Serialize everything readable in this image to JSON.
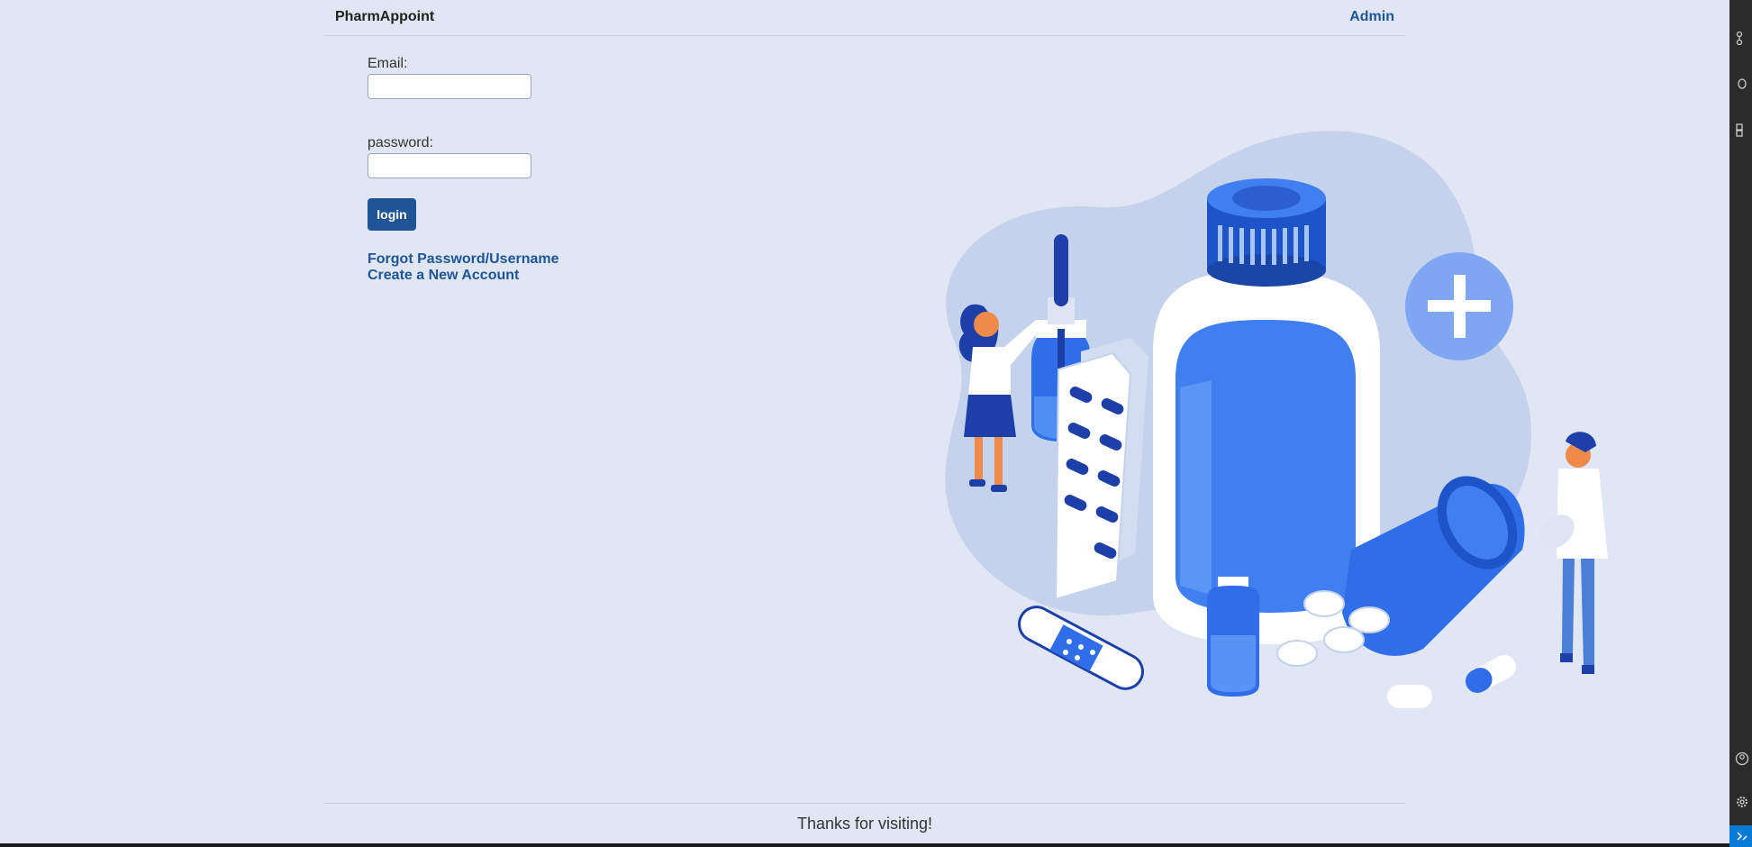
{
  "header": {
    "brand": "PharmAppoint",
    "admin_link": "Admin"
  },
  "login_form": {
    "email_label": "Email:",
    "email_value": "",
    "password_label": "password:",
    "password_value": "",
    "login_button": "login"
  },
  "links": {
    "forgot": "Forgot Password/Username",
    "create_account": "Create a New Account"
  },
  "illustration": {
    "subject": "pharmacy-illustration",
    "icons": [
      "medicine-bottle-icon",
      "pill-blister-icon",
      "plus-icon",
      "dropper-icon",
      "bandage-icon"
    ]
  },
  "footer": {
    "text": "Thanks for visiting!"
  },
  "side_strip": {
    "icons": [
      "source-control-icon",
      "debug-icon",
      "extensions-icon",
      "account-icon",
      "gear-icon",
      "remote-icon"
    ]
  },
  "colors": {
    "background": "#e0e6f3",
    "accent": "#1f5596",
    "illustration_blue": "#3f7ff0"
  }
}
